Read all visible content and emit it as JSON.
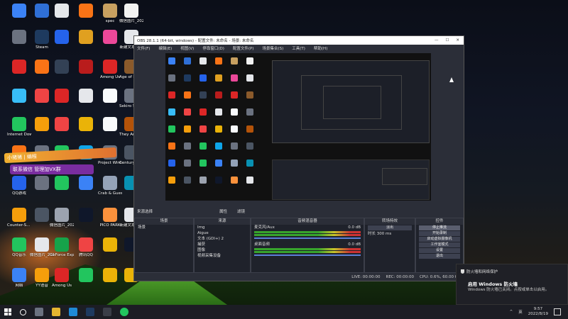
{
  "desktop": {
    "icons": [
      {
        "label": "",
        "color": "#3b82f6"
      },
      {
        "label": "",
        "color": "#2f6fd6"
      },
      {
        "label": "",
        "color": "#e5e7eb"
      },
      {
        "label": "",
        "color": "#f97316"
      },
      {
        "label": "spec",
        "color": "#c8a060"
      },
      {
        "label": "微信图片_2022033...",
        "color": "#f2f2f2"
      },
      {
        "label": "",
        "color": "#6b7280"
      },
      {
        "label": "Steam",
        "color": "#1e3a5f"
      },
      {
        "label": "",
        "color": "#2563eb"
      },
      {
        "label": "",
        "color": "#e0a020"
      },
      {
        "label": "",
        "color": "#ec4899"
      },
      {
        "label": "新建文本文档",
        "color": "#e5e7eb"
      },
      {
        "label": "",
        "color": "#dc2626"
      },
      {
        "label": "",
        "color": "#f97316"
      },
      {
        "label": "",
        "color": "#334155"
      },
      {
        "label": "",
        "color": "#b91c1c"
      },
      {
        "label": "Among Us",
        "color": "#dc2626"
      },
      {
        "label": "Age of Empires IV",
        "color": "#8b5a2b"
      },
      {
        "label": "",
        "color": "#38bdf8"
      },
      {
        "label": "",
        "color": "#ef4444"
      },
      {
        "label": "",
        "color": "#dc2626"
      },
      {
        "label": "",
        "color": "#e5e7eb"
      },
      {
        "label": "",
        "color": "#f8fafc"
      },
      {
        "label": "Sekiro Shadow...",
        "color": "#6b7280"
      },
      {
        "label": "Internet Downlo...",
        "color": "#22c55e"
      },
      {
        "label": "",
        "color": "#f59e0b"
      },
      {
        "label": "",
        "color": "#ef4444"
      },
      {
        "label": "",
        "color": "#eab308"
      },
      {
        "label": "",
        "color": "#f8fafc"
      },
      {
        "label": "They Are Billions",
        "color": "#b45309"
      },
      {
        "label": "",
        "color": "#f97316"
      },
      {
        "label": "",
        "color": "#6b7280"
      },
      {
        "label": "",
        "color": "#22c55e"
      },
      {
        "label": "",
        "color": "#0ea5e9"
      },
      {
        "label": "Project Winter",
        "color": "#6b7280"
      },
      {
        "label": "Century Age of Ashes",
        "color": "#4b5563"
      },
      {
        "label": "QQ游戏",
        "color": "#2563eb"
      },
      {
        "label": "",
        "color": "#6b7280"
      },
      {
        "label": "",
        "color": "#22c55e"
      },
      {
        "label": "",
        "color": "#3b82f6"
      },
      {
        "label": "Crab & Guess",
        "color": "#94a3b8"
      },
      {
        "label": "",
        "color": "#0891b2"
      },
      {
        "label": "Counter-S... Global Off...",
        "color": "#f59e0b"
      },
      {
        "label": "",
        "color": "#4b5563"
      },
      {
        "label": "微信图片_2020101...",
        "color": "#9ca3af"
      },
      {
        "label": "",
        "color": "#0f172a"
      },
      {
        "label": "PICO PARK",
        "color": "#fb923c"
      },
      {
        "label": "新建文本文档",
        "color": "#e5e7eb"
      },
      {
        "label": "QQ音乐",
        "color": "#22c55e"
      },
      {
        "label": "微信图片_2018101...",
        "color": "#e5e7eb"
      },
      {
        "label": "GeForce Experience",
        "color": "#16a34a"
      },
      {
        "label": "腾讯QQ",
        "color": "#ef4444"
      },
      {
        "label": "",
        "color": "#eab308"
      },
      {
        "label": "",
        "color": "#0f172a"
      },
      {
        "label": "网络",
        "color": "#3b82f6"
      },
      {
        "label": "YY语音",
        "color": "#f59e0b"
      },
      {
        "label": "Among Us",
        "color": "#dc2626"
      },
      {
        "label": "",
        "color": "#22c55e"
      },
      {
        "label": "",
        "color": "#eab308"
      },
      {
        "label": "",
        "color": "#eab308"
      }
    ],
    "overlay_text_1": "小猪猪 | 编程",
    "overlay_text_2": "联系微信 管理加VX群"
  },
  "obs": {
    "title": "OBS 28.1.1 (64-bit, windows) - 配置文件: 未命名 - 场景: 未命名",
    "menu": [
      "文件(F)",
      "编辑(E)",
      "视图(V)",
      "停靠窗口(D)",
      "配置文件(P)",
      "场景集合(S)",
      "工具(T)",
      "帮助(H)"
    ],
    "mode_bar": [
      "来源选择",
      "属性",
      "滤镜"
    ],
    "docks": {
      "scenes": {
        "title": "场景",
        "items": [
          "场景"
        ]
      },
      "sources": {
        "title": "来源",
        "items": [
          "Img",
          "Aigue",
          "文本 (GDI+) 2",
          "捕获",
          "图像",
          "视频采集设备"
        ]
      },
      "mixer": {
        "title": "音频混音器",
        "tracks": [
          {
            "name": "麦克风/Aux",
            "db": "0.0 dB"
          },
          {
            "name": "桌面音频",
            "db": "0.0 dB"
          }
        ]
      },
      "transitions": {
        "title": "转场特效",
        "type": "淡出",
        "duration_label": "时长",
        "duration": "300 ms"
      },
      "controls": {
        "title": "控件",
        "buttons": [
          "停止推流",
          "开始录制",
          "启动虚拟摄像机",
          "工作室模式",
          "设置",
          "退出"
        ]
      }
    },
    "status": [
      "LIVE: 00:00:00",
      "REC: 00:00:00",
      "CPU: 0.6%, 60.00 fps"
    ]
  },
  "toast": {
    "header": "防火墙和网络保护",
    "title": "启用 Windows 防火墙",
    "body": "Windows 防火墙已关闭。点按或单击以启用。"
  },
  "taskbar": {
    "tray_lang": "英",
    "time": "9:57",
    "date": "2022/8/19"
  }
}
